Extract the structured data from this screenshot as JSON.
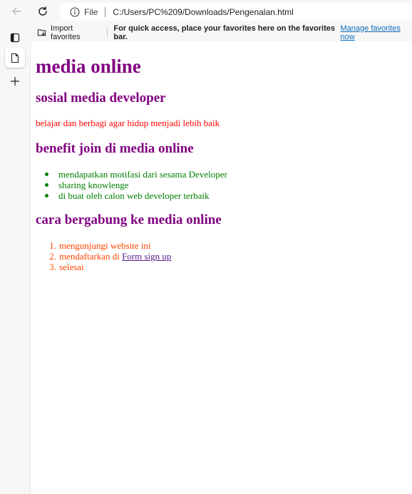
{
  "browser": {
    "address_scheme": "File",
    "address_url": "C:/Users/PC%209/Downloads/Pengenalan.html"
  },
  "favorites_bar": {
    "import_label": "Import favorites",
    "message": "For quick access, place your favorites here on the favorites bar.",
    "manage_link": "Manage favorites now"
  },
  "page": {
    "title": "media online",
    "subtitle": "sosial media developer",
    "intro": "belajar dan berbagi agar hidup menjadi lebih baik",
    "benefits_heading": "benefit join di media online",
    "benefits": [
      "mendapatkan motifasi dari sesama Developer",
      "sharing knowlenge",
      "di buat oleh calon web developer terbaik"
    ],
    "join_heading": "cara bergabung ke media online",
    "steps": [
      {
        "num": "1.",
        "text": "mengunjungi website ini"
      },
      {
        "num": "2.",
        "text": "mendaftarkan di ",
        "link": "Form sign up"
      },
      {
        "num": "3.",
        "text": "selesai"
      }
    ]
  },
  "colors": {
    "heading": "#800080",
    "intro": "#ff0000",
    "benefits": "#008000",
    "steps": "#ff4500",
    "link": "#551a8b"
  },
  "icons": {
    "back": "arrow-left-icon",
    "refresh": "refresh-icon",
    "info": "info-icon",
    "tabs": "tab-actions-icon",
    "page": "page-icon",
    "new_tab": "plus-icon",
    "import": "import-favorites-icon"
  }
}
